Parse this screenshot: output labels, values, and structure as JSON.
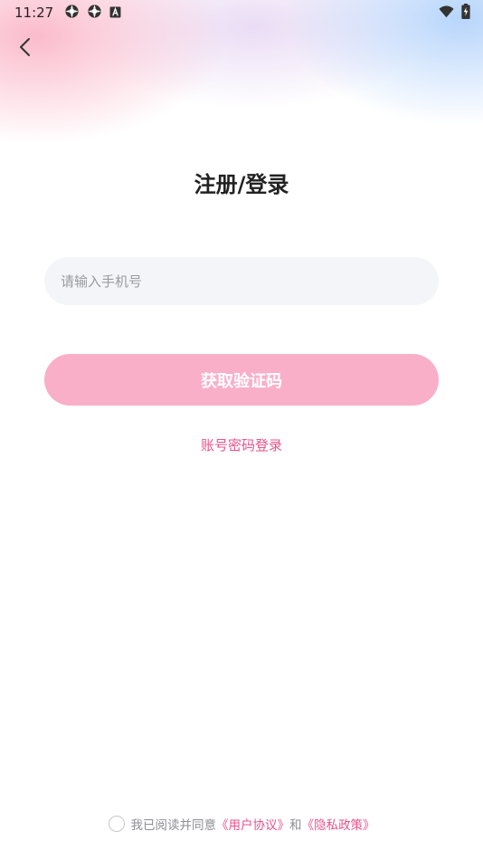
{
  "status_bar": {
    "time": "11:27",
    "left_icons": [
      "settings-gear-icon",
      "settings-gear-icon",
      "app-a-icon"
    ],
    "right_icons": [
      "wifi-icon",
      "battery-charging-icon"
    ]
  },
  "header": {
    "back_icon": "chevron-left-icon",
    "title": "注册/登录"
  },
  "form": {
    "phone_placeholder": "请输入手机号",
    "phone_value": "",
    "get_code_label": "获取验证码",
    "password_login_link": "账号密码登录"
  },
  "agreement": {
    "checked": false,
    "prefix": "我已阅读并同意",
    "user_agreement": "《用户协议》",
    "conjunction": "和",
    "privacy_policy": "《隐私政策》"
  },
  "colors": {
    "accent": "#e9528a",
    "button_bg": "#f9afc8",
    "input_bg": "#f4f5f8"
  }
}
